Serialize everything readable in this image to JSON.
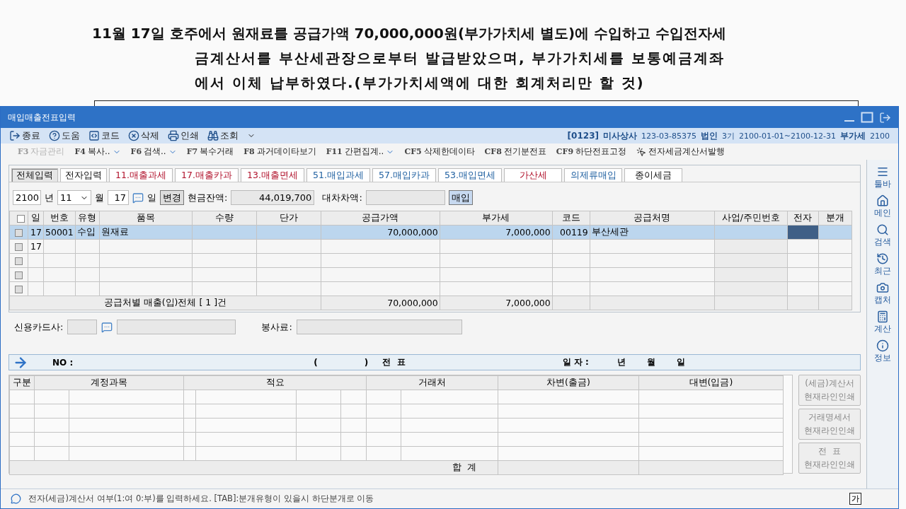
{
  "question": {
    "lines": [
      "11월 17일 호주에서 원재료를 공급가액 70,000,000원(부가가치세 별도)에 수입하고 수입전자세",
      "금계산서를 부산세관장으로부터 발급받았으며, 부가가치세를 보통예금계좌",
      "에서 이체 납부하였다.(부가가치세액에 대한 회계처리만 할 것)"
    ]
  },
  "window": {
    "title": "매입매출전표입력"
  },
  "toolbar": [
    {
      "kind": "exit",
      "label": "종료"
    },
    {
      "kind": "help",
      "label": "도움"
    },
    {
      "kind": "code",
      "label": "코드"
    },
    {
      "kind": "delete",
      "label": "삭제"
    },
    {
      "kind": "print",
      "label": "인쇄"
    },
    {
      "kind": "lookup",
      "label": "조회"
    }
  ],
  "company": {
    "code": "[0123]",
    "name": "미사상사",
    "reg_no": "123-03-85375",
    "entity": "법인",
    "term": "3기",
    "period": "2100-01-01~2100-12-31",
    "vat_label": "부가세",
    "vat_year": "2100"
  },
  "function_keys": [
    {
      "key": "F3",
      "label": "자금관리",
      "disabled": true,
      "dropdown": false
    },
    {
      "key": "F4",
      "label": "복사..",
      "disabled": false,
      "dropdown": true
    },
    {
      "key": "F6",
      "label": "검색..",
      "disabled": false,
      "dropdown": true
    },
    {
      "key": "F7",
      "label": "복수거래",
      "disabled": false,
      "dropdown": false
    },
    {
      "key": "F8",
      "label": "과거데이타보기",
      "disabled": false,
      "dropdown": false
    },
    {
      "key": "F11",
      "label": "간편집계..",
      "disabled": false,
      "dropdown": true
    },
    {
      "key": "CF5",
      "label": "삭제한데이타",
      "disabled": false,
      "dropdown": false
    },
    {
      "key": "CF8",
      "label": "전기분전표",
      "disabled": false,
      "dropdown": false
    },
    {
      "key": "CF9",
      "label": "하단전표고정",
      "disabled": false,
      "dropdown": false
    },
    {
      "label": "전자세금계산서발행",
      "disabled": false,
      "dropdown": false
    }
  ],
  "tabs": [
    {
      "label": "전체입력",
      "selected": true,
      "kind": "general"
    },
    {
      "label": "전자입력",
      "selected": false,
      "kind": "general"
    },
    {
      "label": "11.매출과세",
      "selected": false,
      "kind": "sales"
    },
    {
      "label": "17.매출카과",
      "selected": false,
      "kind": "sales"
    },
    {
      "label": "13.매출면세",
      "selected": false,
      "kind": "sales"
    },
    {
      "label": "51.매입과세",
      "selected": false,
      "kind": "purchase"
    },
    {
      "label": "57.매입카과",
      "selected": false,
      "kind": "purchase"
    },
    {
      "label": "53.매입면세",
      "selected": false,
      "kind": "purchase"
    },
    {
      "label": "가산세",
      "selected": false,
      "kind": "sales"
    },
    {
      "label": "의제류매입",
      "selected": false,
      "kind": "purchase"
    },
    {
      "label": "종이세금",
      "selected": false,
      "kind": "general"
    }
  ],
  "date_bar": {
    "year": "2100",
    "year_unit": "년",
    "month": "11",
    "month_unit": "월",
    "day": "17",
    "day_unit": "일",
    "change_button": "변경",
    "cash_label": "현금잔액:",
    "cash_value": "44,019,700",
    "diff_label": "대차차액:",
    "mode_button": "매입"
  },
  "grid": {
    "all_checked": false,
    "columns": [
      "일",
      "번호",
      "유형",
      "품목",
      "수량",
      "단가",
      "공급가액",
      "부가세",
      "코드",
      "공급처명",
      "사업/주민번호",
      "전자",
      "분개"
    ],
    "rows": [
      {
        "checked": false,
        "selected": true,
        "e_focused": true,
        "day": "17",
        "number": "50001",
        "type": "수입",
        "item": "원재료",
        "supply": "70,000,000",
        "vat": "7,000,000",
        "code": "00119",
        "supplier": "부산세관"
      },
      {
        "checked": false,
        "selected": false,
        "e_focused": false,
        "day": "17"
      },
      {
        "checked": false,
        "selected": false,
        "e_focused": false
      },
      {
        "checked": false,
        "selected": false,
        "e_focused": false
      },
      {
        "checked": false,
        "selected": false,
        "e_focused": false
      }
    ],
    "summary": {
      "label": "공급처별 매출(입)전체 [ 1 ]건",
      "supply": "70,000,000",
      "vat": "7,000,000"
    }
  },
  "card_row": {
    "card_label": "신용카드사:",
    "fee_label": "봉사료:"
  },
  "voucher": {
    "no_label": "NO :",
    "paren_open": "(",
    "paren_close": ")",
    "title": "전  표",
    "date_label": "일 자 :",
    "year": "년",
    "month": "월",
    "day": "일"
  },
  "journal": {
    "columns": [
      "구분",
      "계정과목",
      "적요",
      "거래처",
      "차변(출금)",
      "대변(입금)"
    ],
    "total_label": "합  계"
  },
  "side_buttons": [
    {
      "line1": "(세금)계산서",
      "line2": "현재라인인쇄"
    },
    {
      "line1": "거래명세서",
      "line2": "현재라인인쇄"
    },
    {
      "line1": "전  표",
      "line2": "현재라인인쇄"
    }
  ],
  "sidebar": [
    {
      "kind": "toolbar",
      "label": "툴바"
    },
    {
      "kind": "main",
      "label": "메인"
    },
    {
      "kind": "search",
      "label": "검색"
    },
    {
      "kind": "recent",
      "label": "최근"
    },
    {
      "kind": "capture",
      "label": "캡처"
    },
    {
      "kind": "calc",
      "label": "계산"
    },
    {
      "kind": "info",
      "label": "정보"
    }
  ],
  "status_bar": {
    "message": "전자(세금)계산서 여부(1:여 0:부)를 입력하세요. [TAB]:분개유형이 있을시 하단분개로 이동",
    "ime": "가"
  }
}
